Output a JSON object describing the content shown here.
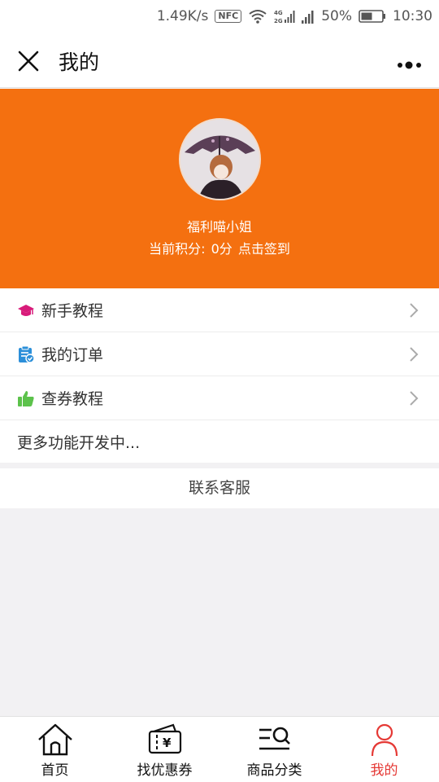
{
  "status_bar": {
    "speed": "1.49K/s",
    "nfc": "NFC",
    "network": "4G",
    "network2": "2G",
    "battery": "50%",
    "time": "10:30"
  },
  "navbar": {
    "title": "我的",
    "close_icon": "close-icon",
    "more_icon": "more-dots-icon"
  },
  "profile": {
    "name": "福利喵小姐",
    "points_label": "当前积分:",
    "points_value": "0分",
    "checkin": "点击签到",
    "bg_color": "#f47010"
  },
  "menu": {
    "items": [
      {
        "label": "新手教程",
        "icon": "graduation-cap-icon",
        "icon_color": "#d81b7a"
      },
      {
        "label": "我的订单",
        "icon": "order-clipboard-icon",
        "icon_color": "#2b8fd9"
      },
      {
        "label": "查券教程",
        "icon": "thumbs-up-icon",
        "icon_color": "#5cc24b"
      }
    ],
    "more": "更多功能开发中..."
  },
  "contact": "联系客服",
  "tabbar": {
    "tabs": [
      {
        "label": "首页",
        "icon": "home-icon"
      },
      {
        "label": "找优惠券",
        "icon": "coupon-wallet-icon"
      },
      {
        "label": "商品分类",
        "icon": "category-search-icon"
      },
      {
        "label": "我的",
        "icon": "user-icon",
        "active": true
      }
    ],
    "active_color": "#e53935"
  }
}
